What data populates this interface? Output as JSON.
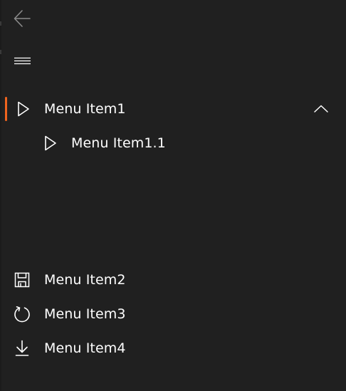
{
  "colors": {
    "background": "#202020",
    "text": "#ffffff",
    "icon": "#ffffff",
    "back_icon": "#8a8a8a",
    "accent": "#f0641e"
  },
  "header": {
    "back_icon": "arrow-left-icon",
    "menu_icon": "hamburger-icon"
  },
  "menu": {
    "item1": {
      "label": "Menu Item1",
      "icon": "play-outline-icon",
      "expanded": true,
      "selected": true,
      "chevron": "chevron-up-icon"
    },
    "item1_1": {
      "label": "Menu Item1.1",
      "icon": "play-outline-icon"
    }
  },
  "footer_menu": {
    "item2": {
      "label": "Menu Item2",
      "icon": "save-icon"
    },
    "item3": {
      "label": "Menu Item3",
      "icon": "refresh-icon"
    },
    "item4": {
      "label": "Menu Item4",
      "icon": "download-icon"
    }
  }
}
